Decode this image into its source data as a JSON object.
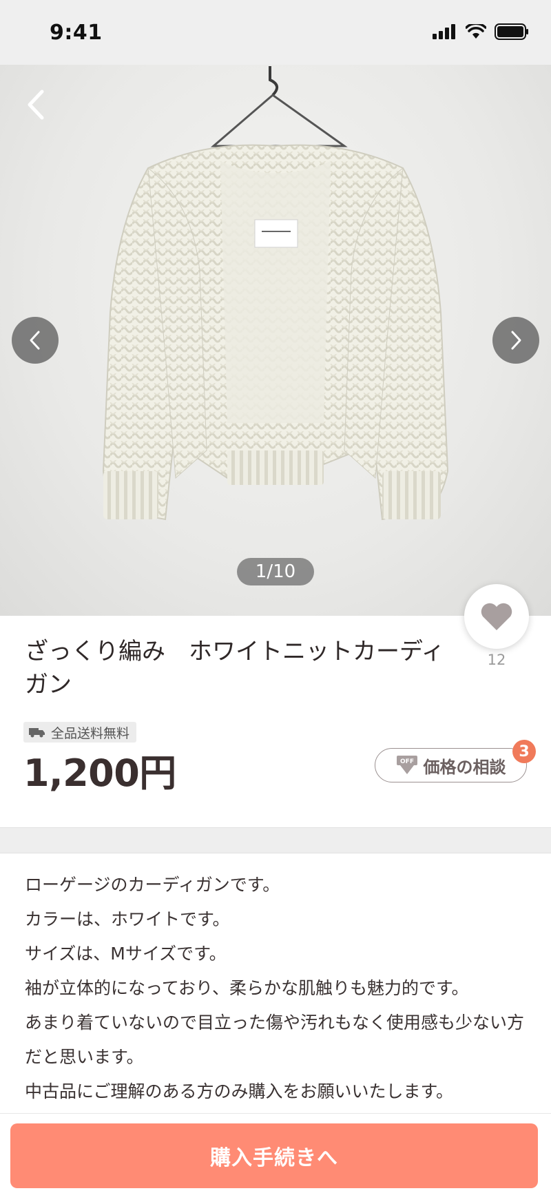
{
  "status_bar": {
    "time": "9:41"
  },
  "product": {
    "image_counter": "1/10",
    "like_count": "12",
    "title": "ざっくり編み　ホワイトニットカーディガン",
    "shipping_badge": "全品送料無料",
    "price": "1,200円",
    "offer_button_label": "価格の相談",
    "offer_button_icon_text": "OFF",
    "offer_count": "3"
  },
  "description_lines": [
    "ローゲージのカーディガンです。",
    "カラーは、ホワイトです。",
    "サイズは、Mサイズです。",
    "袖が立体的になっており、柔らかな肌触りも魅力的です。",
    "あまり着ていないので目立った傷や汚れもなく使用感も少ない方だと思います。",
    "中古品にご理解のある方のみ購入をお願いいたします。"
  ],
  "footer": {
    "purchase_label": "購入手続きへ"
  },
  "colors": {
    "accent": "#ff8b74",
    "badge": "#f07a5a",
    "heart": "#a89f9f"
  },
  "icons": [
    "signal-icon",
    "wifi-icon",
    "battery-icon",
    "back-icon",
    "chevron-left-icon",
    "chevron-right-icon",
    "heart-icon",
    "truck-icon",
    "off-tag-icon"
  ]
}
